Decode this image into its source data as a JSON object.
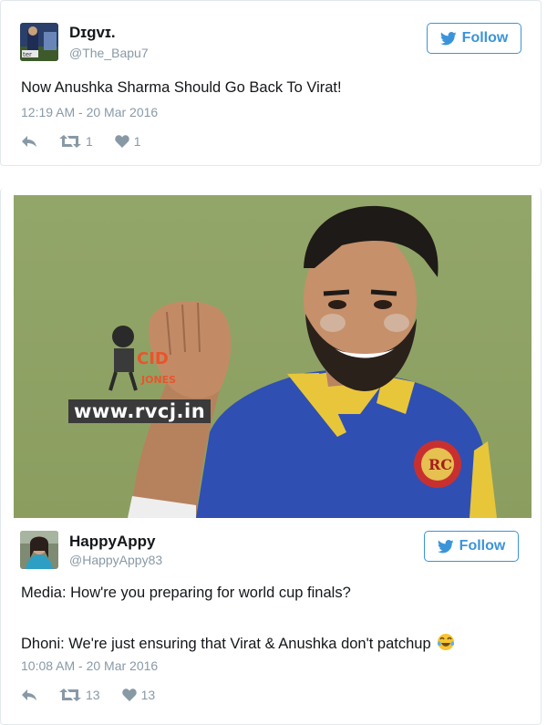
{
  "tweet1": {
    "author_name": "Dɪgvɪ.",
    "author_handle": "@The_Bapu7",
    "follow_label": "Follow",
    "text": "Now Anushka Sharma Should Go Back To Virat!",
    "timestamp": "12:19 AM - 20 Mar 2016",
    "retweet_count": "1",
    "like_count": "1"
  },
  "image": {
    "watermark_url": "www.rvcj.in",
    "watermark_logo": "CID JONES",
    "badge_text": "RC"
  },
  "tweet2": {
    "author_name": "HappyAppy",
    "author_handle": "@HappyAppy83",
    "follow_label": "Follow",
    "text_line1": "Media: How're you preparing for world cup finals?",
    "text_line2": "Dhoni: We're just ensuring that Virat & Anushka don't patchup",
    "timestamp": "10:08 AM - 20 Mar 2016",
    "retweet_count": "13",
    "like_count": "13"
  },
  "colors": {
    "twitter_blue": "#3b94d9",
    "meta_gray": "#8899a6",
    "text_dark": "#14171a",
    "card_border": "#e1e8ed"
  },
  "icons": [
    "reply-icon",
    "retweet-icon",
    "heart-icon",
    "twitter-bird-icon",
    "tears-of-joy-emoji"
  ]
}
